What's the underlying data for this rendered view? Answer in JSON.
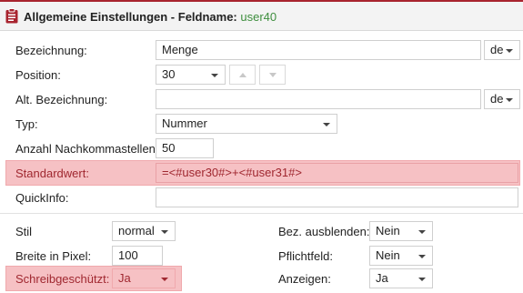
{
  "header": {
    "title": "Allgemeine Einstellungen - Feldname:",
    "field_name": "user40",
    "icon": "clipboard-icon",
    "accent": "#a8242f",
    "field_color": "#3e8e3e"
  },
  "form": {
    "bezeichnung": {
      "label": "Bezeichnung:",
      "value": "Menge",
      "lang": "de"
    },
    "position": {
      "label": "Position:",
      "value": "30",
      "up_icon": "chevron-up-icon",
      "down_icon": "chevron-down-icon"
    },
    "alt_bezeichnung": {
      "label": "Alt. Bezeichnung:",
      "value": "",
      "lang": "de"
    },
    "typ": {
      "label": "Typ:",
      "value": "Nummer"
    },
    "nachkommastellen": {
      "label": "Anzahl Nachkommastellen",
      "value": "50"
    },
    "standardwert": {
      "label": "Standardwert:",
      "value": "=<#user30#>+<#user31#>",
      "highlight": "#f6c1c4"
    },
    "quickinfo": {
      "label": "QuickInfo:",
      "value": ""
    }
  },
  "options": {
    "stil": {
      "label": "Stil",
      "value": "normal"
    },
    "breite": {
      "label": "Breite in Pixel:",
      "value": "100"
    },
    "schreibgeschuetzt": {
      "label": "Schreibgeschützt:",
      "value": "Ja"
    },
    "bez_ausblenden": {
      "label": "Bez. ausblenden:",
      "value": "Nein"
    },
    "pflichtfeld": {
      "label": "Pflichtfeld:",
      "value": "Nein"
    },
    "anzeigen": {
      "label": "Anzeigen:",
      "value": "Ja"
    }
  }
}
